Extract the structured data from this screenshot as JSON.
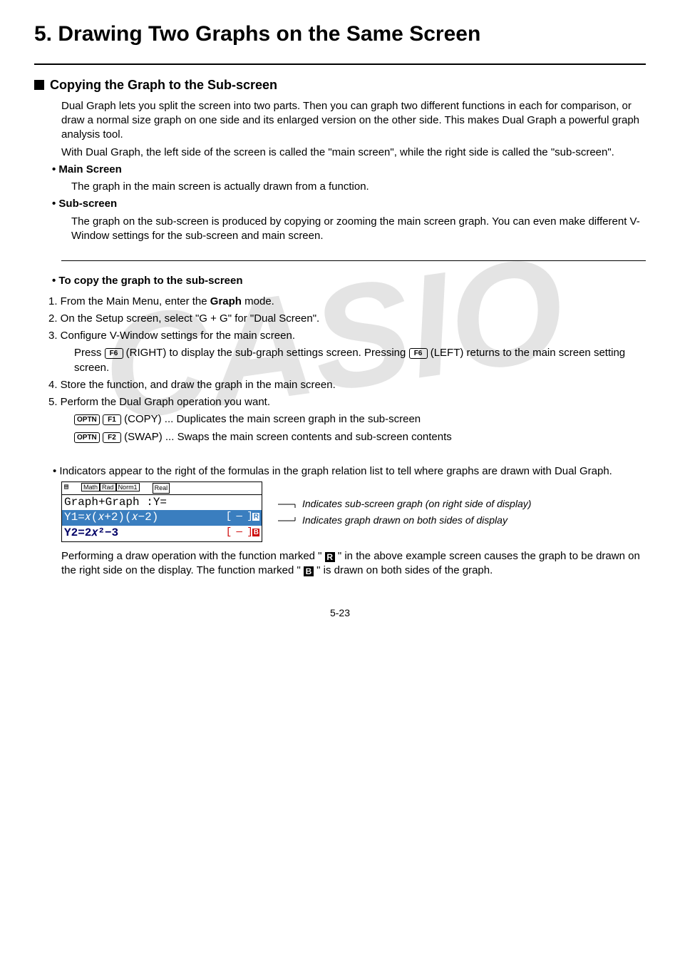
{
  "chapter_title": "5. Drawing Two Graphs on the Same Screen",
  "section_title": "Copying the Graph to the Sub-screen",
  "intro_p1": "Dual Graph lets you split the screen into two parts. Then you can graph two different functions in each for comparison, or draw a normal size graph on one side and its enlarged version on the other side. This makes Dual Graph a powerful graph analysis tool.",
  "intro_p2": "With Dual Graph, the left side of the screen is called the \"main screen\", while the right side is called the \"sub-screen\".",
  "main_screen_label": "Main Screen",
  "main_screen_text": "The graph in the main screen is actually drawn from a function.",
  "sub_screen_label": "Sub-screen",
  "sub_screen_text": "The graph on the sub-screen is produced by copying or zooming the main screen graph. You can even make different V-Window settings for the sub-screen and main screen.",
  "proc_title": "To copy the graph to the sub-screen",
  "steps": {
    "s1_pre": "1. From the Main Menu, enter the ",
    "s1_bold": "Graph",
    "s1_post": " mode.",
    "s2": "2. On the Setup screen, select \"G + G\" for \"Dual Screen\".",
    "s3": "3. Configure V-Window settings for the main screen.",
    "s3sub_a": "Press ",
    "s3sub_b": " (RIGHT) to display the sub-graph settings screen. Pressing ",
    "s3sub_c": " (LEFT) returns to the main screen setting screen.",
    "s4": "4. Store the function, and draw the graph in the main screen.",
    "s5": "5. Perform the Dual Graph operation you want.",
    "s5a_mid": " (COPY) ... Duplicates the main screen graph in the sub-screen",
    "s5b_mid": " (SWAP) ... Swaps the main screen contents and sub-screen contents"
  },
  "keys": {
    "optn": "OPTN",
    "f1": "F1",
    "f2": "F2",
    "f6": "F6"
  },
  "note": "• Indicators appear to the right of the formulas in the graph relation list to tell where graphs are drawn with Dual Graph.",
  "calc": {
    "status_math": "Math",
    "status_rad": "Rad",
    "status_norm": "Norm1",
    "status_real": "Real",
    "line_head": "Graph+Graph :Y=",
    "line_y1_left": "Y1=𝑥(𝑥+2)(𝑥−2)",
    "tag1_bracket": "[ — ]",
    "tag1_box": "R",
    "line_y2_left": "Y2=2𝑥²−3",
    "tag2_bracket": "[ — ]",
    "tag2_box": "B"
  },
  "annot1": "Indicates sub-screen graph (on right side of display)",
  "annot2": "Indicates graph drawn on both sides of display",
  "closing_a": "Performing a draw operation with the function marked \" ",
  "closing_b": " \" in the above example screen causes the graph to be drawn on the right side on the display. The function marked \" ",
  "closing_c": " \" is drawn on both sides of the graph.",
  "icon_R": "R",
  "icon_B": "B",
  "page_no": "5-23"
}
